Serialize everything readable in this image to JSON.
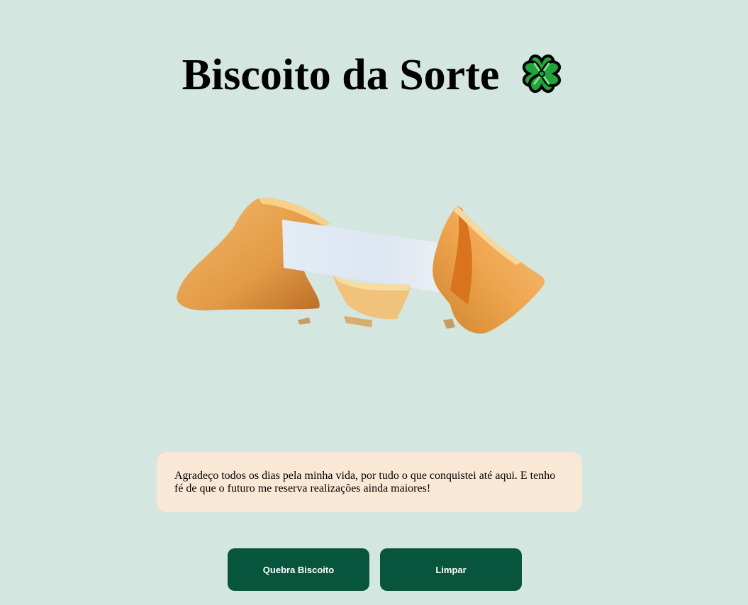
{
  "header": {
    "title": "Biscoito da Sorte",
    "icon": "four-leaf-clover-icon"
  },
  "cookie_image": {
    "alt": "fortune-cookie-image"
  },
  "fortune": {
    "text": "Agradeço todos os dias pela minha vida, por tudo o que conquistei até aqui. E tenho fé de que o futuro me reserva realizações ainda maiores!"
  },
  "actions": {
    "break_label": "Quebra Biscoito",
    "clear_label": "Limpar"
  },
  "colors": {
    "background": "#d3e6e0",
    "phrase_background": "#f9e8d6",
    "button": "#06553c",
    "clover_green": "#1fa53a"
  }
}
